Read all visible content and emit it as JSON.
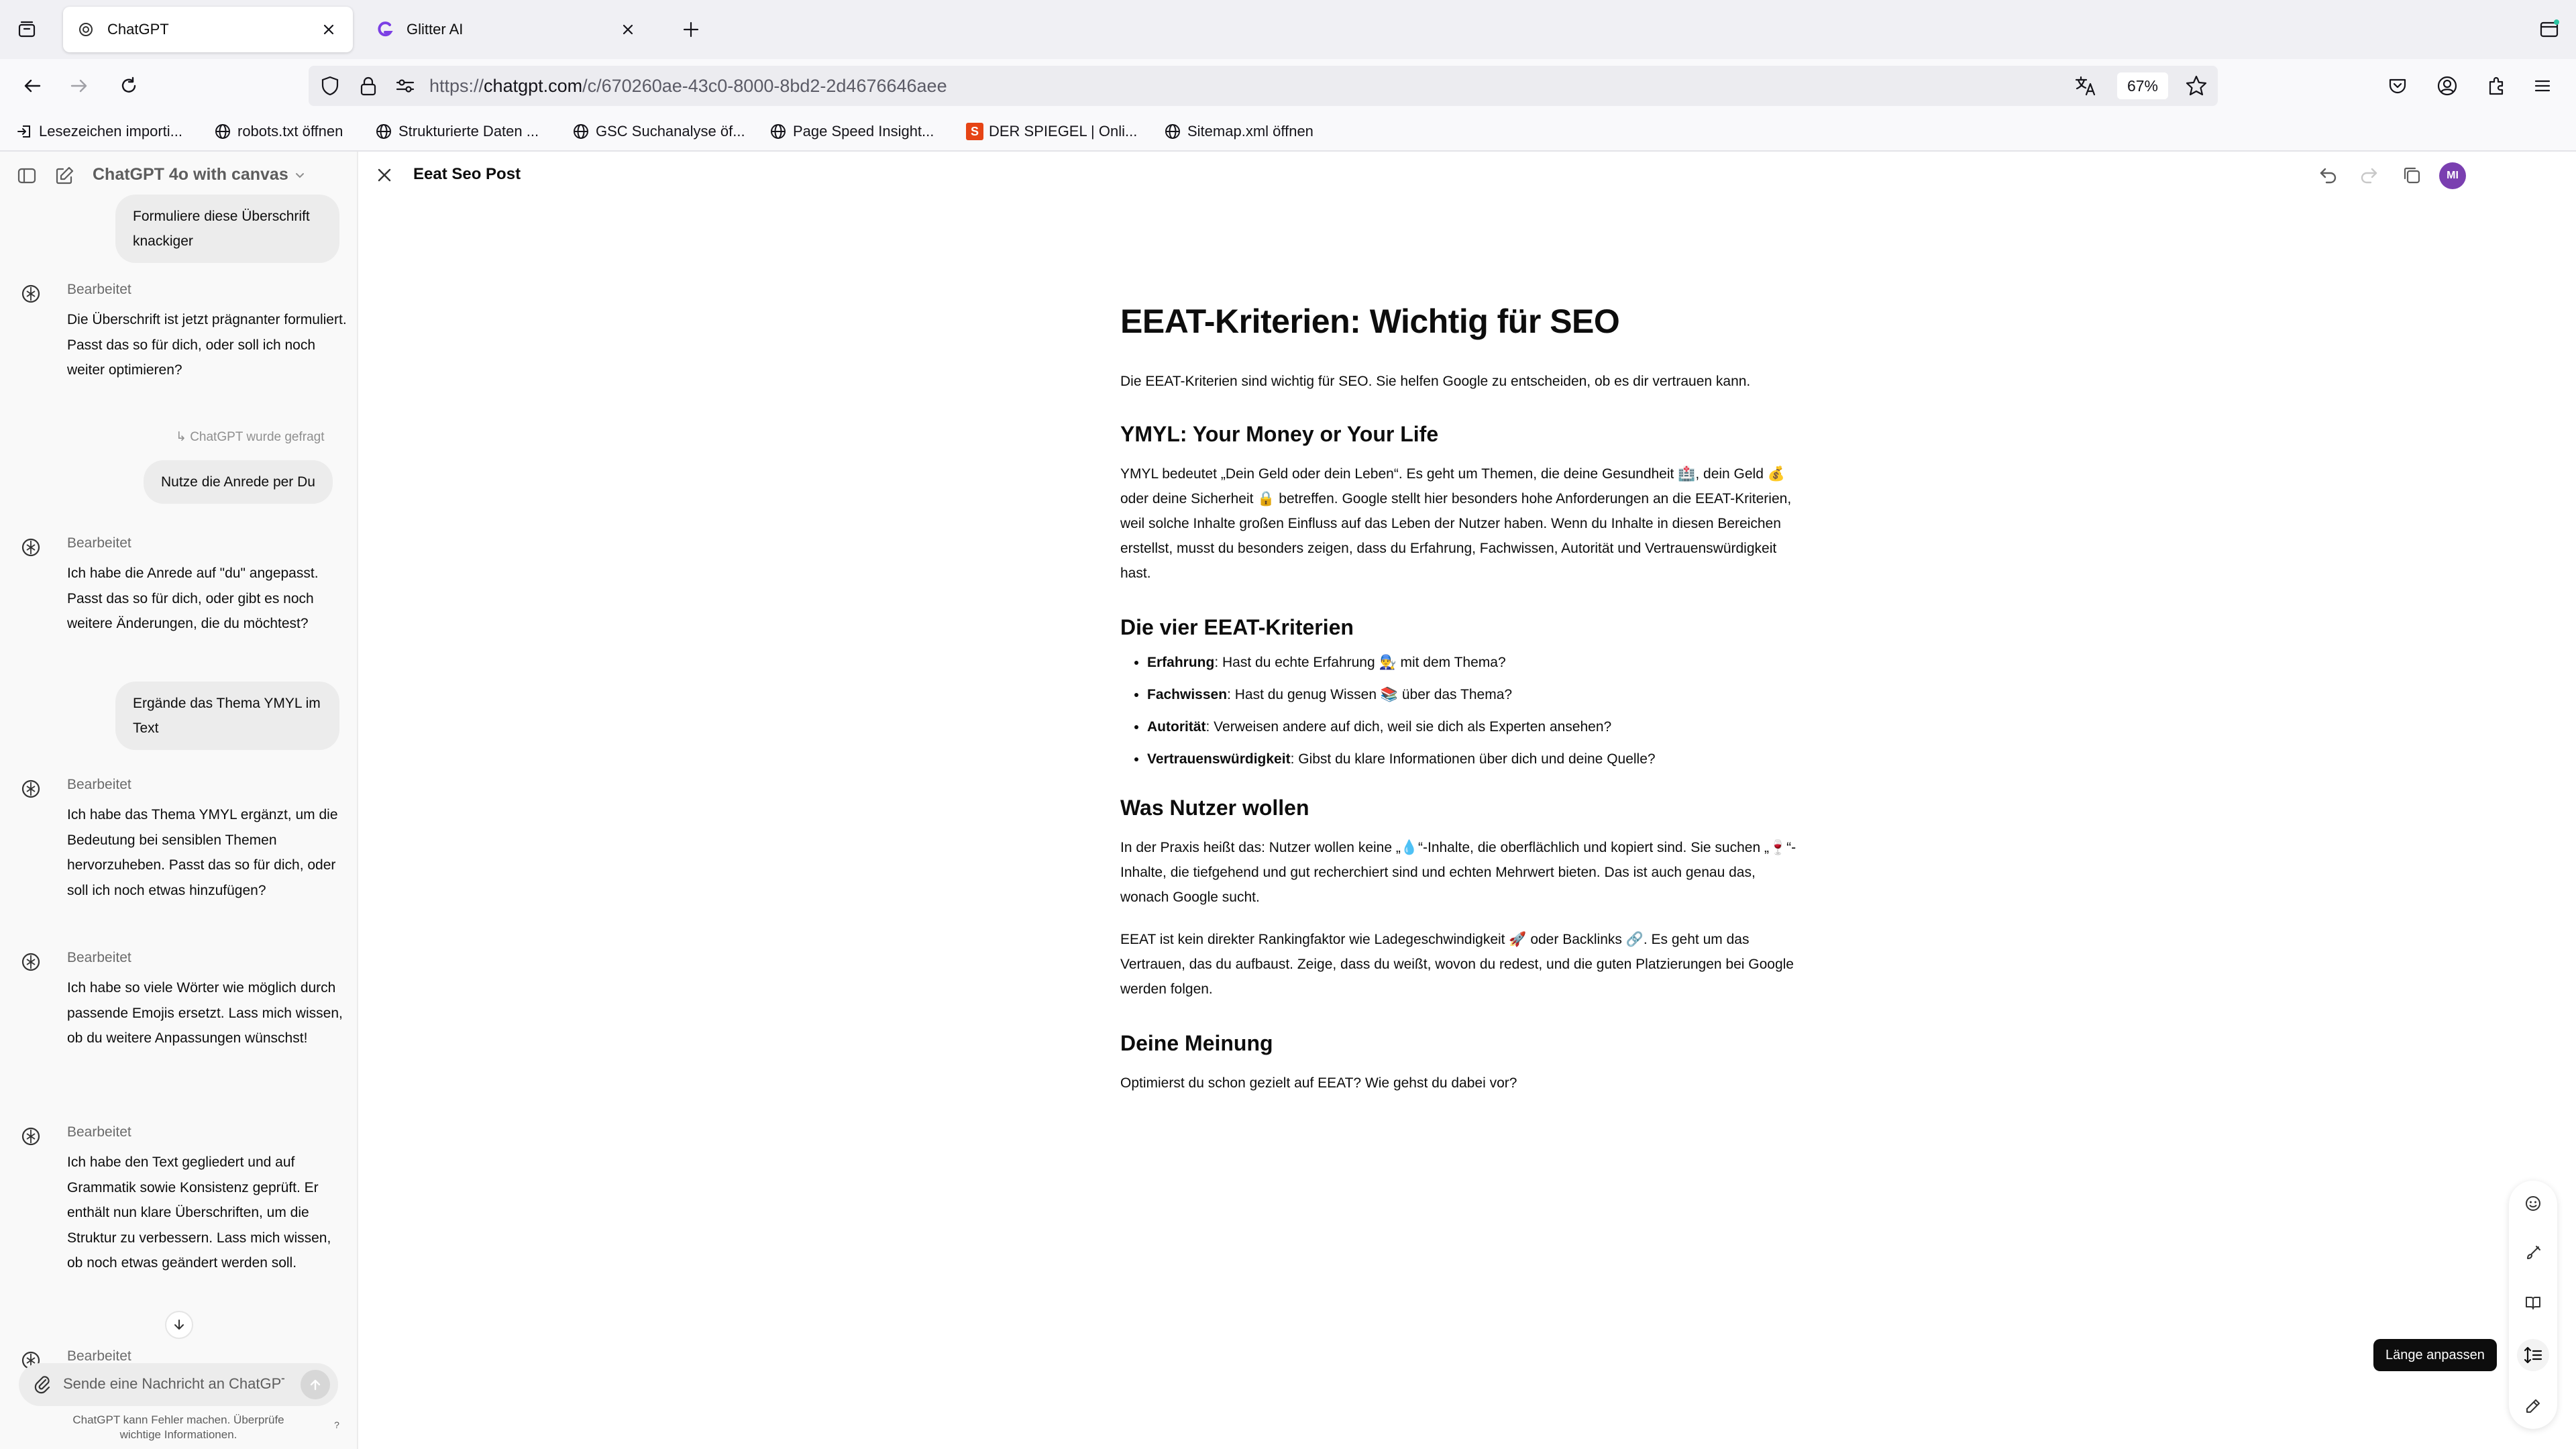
{
  "browser": {
    "tabs": [
      {
        "title": "ChatGPT",
        "active": true,
        "icon": "chatgpt-icon"
      },
      {
        "title": "Glitter AI",
        "active": false,
        "icon": "glitter-ai-icon"
      }
    ],
    "url": {
      "prefix": "https://",
      "host": "chatgpt.com",
      "path": "/c/670260ae-43c0-8000-8bd2-2d4676646aee"
    },
    "zoom": "67%",
    "bookmarks": [
      {
        "label": "Lesezeichen importi...",
        "icon": "import-icon"
      },
      {
        "label": "robots.txt öffnen",
        "icon": "globe-icon"
      },
      {
        "label": "Strukturierte Daten ...",
        "icon": "globe-icon"
      },
      {
        "label": "GSC Suchanalyse öf...",
        "icon": "globe-icon"
      },
      {
        "label": "Page Speed Insight...",
        "icon": "globe-icon"
      },
      {
        "label": "DER SPIEGEL | Onli...",
        "icon": "spiegel-icon",
        "icon_text": "S",
        "color": "#e64415"
      },
      {
        "label": "Sitemap.xml öffnen",
        "icon": "globe-icon"
      }
    ]
  },
  "sidebar": {
    "model": "ChatGPT 4o with canvas",
    "messages": [
      {
        "role": "user",
        "text": "Formuliere diese Überschrift knackiger"
      },
      {
        "role": "assistant",
        "label": "Bearbeitet",
        "text": "Die Überschrift ist jetzt prägnanter formuliert. Passt das so für dich, oder soll ich noch weiter optimieren?"
      },
      {
        "role": "meta",
        "text": "ChatGPT wurde gefragt"
      },
      {
        "role": "user",
        "text": "Nutze die Anrede per Du"
      },
      {
        "role": "assistant",
        "label": "Bearbeitet",
        "text": "Ich habe die Anrede auf \"du\" angepasst. Passt das so für dich, oder gibt es noch weitere Änderungen, die du möchtest?"
      },
      {
        "role": "user",
        "text": "Ergände das Thema YMYL im Text"
      },
      {
        "role": "assistant",
        "label": "Bearbeitet",
        "text": "Ich habe das Thema YMYL ergänzt, um die Bedeutung bei sensiblen Themen hervorzuheben. Passt das so für dich, oder soll ich noch etwas hinzufügen?"
      },
      {
        "role": "assistant",
        "label": "Bearbeitet",
        "text": "Ich habe so viele Wörter wie möglich durch passende Emojis ersetzt. Lass mich wissen, ob du weitere Anpassungen wünschst!"
      },
      {
        "role": "assistant",
        "label": "Bearbeitet",
        "text": "Ich habe den Text gegliedert und auf Grammatik sowie Konsistenz geprüft. Er enthält nun klare Überschriften, um die Struktur zu verbessern. Lass mich wissen, ob noch etwas geändert werden soll."
      },
      {
        "role": "assistant",
        "label": "Bearbeitet",
        "text": ""
      }
    ],
    "composer_placeholder": "Sende eine Nachricht an ChatGPT",
    "disclaimer": "ChatGPT kann Fehler machen. Überprüfe wichtige Informationen.",
    "help": "?"
  },
  "canvas": {
    "title": "Eeat Seo Post",
    "avatar": "MI",
    "avatar_color": "#7a3fb0",
    "h1": "EEAT-Kriterien: Wichtig für SEO",
    "intro": "Die EEAT-Kriterien sind wichtig für SEO. Sie helfen Google zu entscheiden, ob es dir vertrauen kann.",
    "s1_h": "YMYL: Your Money or Your Life",
    "s1_p": "YMYL bedeutet „Dein Geld oder dein Leben“. Es geht um Themen, die deine Gesundheit 🏥, dein Geld 💰 oder deine Sicherheit 🔒 betreffen. Google stellt hier besonders hohe Anforderungen an die EEAT-Kriterien, weil solche Inhalte großen Einfluss auf das Leben der Nutzer haben. Wenn du Inhalte in diesen Bereichen erstellst, musst du besonders zeigen, dass du Erfahrung, Fachwissen, Autorität und Vertrauenswürdigkeit hast.",
    "s2_h": "Die vier EEAT-Kriterien",
    "criteria": [
      {
        "term": "Erfahrung",
        "text": ": Hast du echte Erfahrung 👨‍🔧 mit dem Thema?"
      },
      {
        "term": "Fachwissen",
        "text": ": Hast du genug Wissen 📚 über das Thema?"
      },
      {
        "term": "Autorität",
        "text": ": Verweisen andere auf dich, weil sie dich als Experten ansehen?"
      },
      {
        "term": "Vertrauenswürdigkeit",
        "text": ": Gibst du klare Informationen über dich und deine Quelle?"
      }
    ],
    "s3_h": "Was Nutzer wollen",
    "s3_p1": "In der Praxis heißt das: Nutzer wollen keine „💧“-Inhalte, die oberflächlich und kopiert sind. Sie suchen „🍷“-Inhalte, die tiefgehend und gut recherchiert sind und echten Mehrwert bieten. Das ist auch genau das, wonach Google sucht.",
    "s3_p2": "EEAT ist kein direkter Rankingfaktor wie Ladegeschwindigkeit 🚀 oder Backlinks 🔗. Es geht um das Vertrauen, das du aufbaust. Zeige, dass du weißt, wovon du redest, und die guten Platzierungen bei Google werden folgen.",
    "s4_h": "Deine Meinung",
    "s4_p": "Optimierst du schon gezielt auf EEAT? Wie gehst du dabei vor?",
    "tools": [
      "emoji-icon",
      "polish-icon",
      "reading-level-icon",
      "adjust-length-icon",
      "edit-suggestions-icon"
    ],
    "tooltip": "Länge anpassen"
  }
}
